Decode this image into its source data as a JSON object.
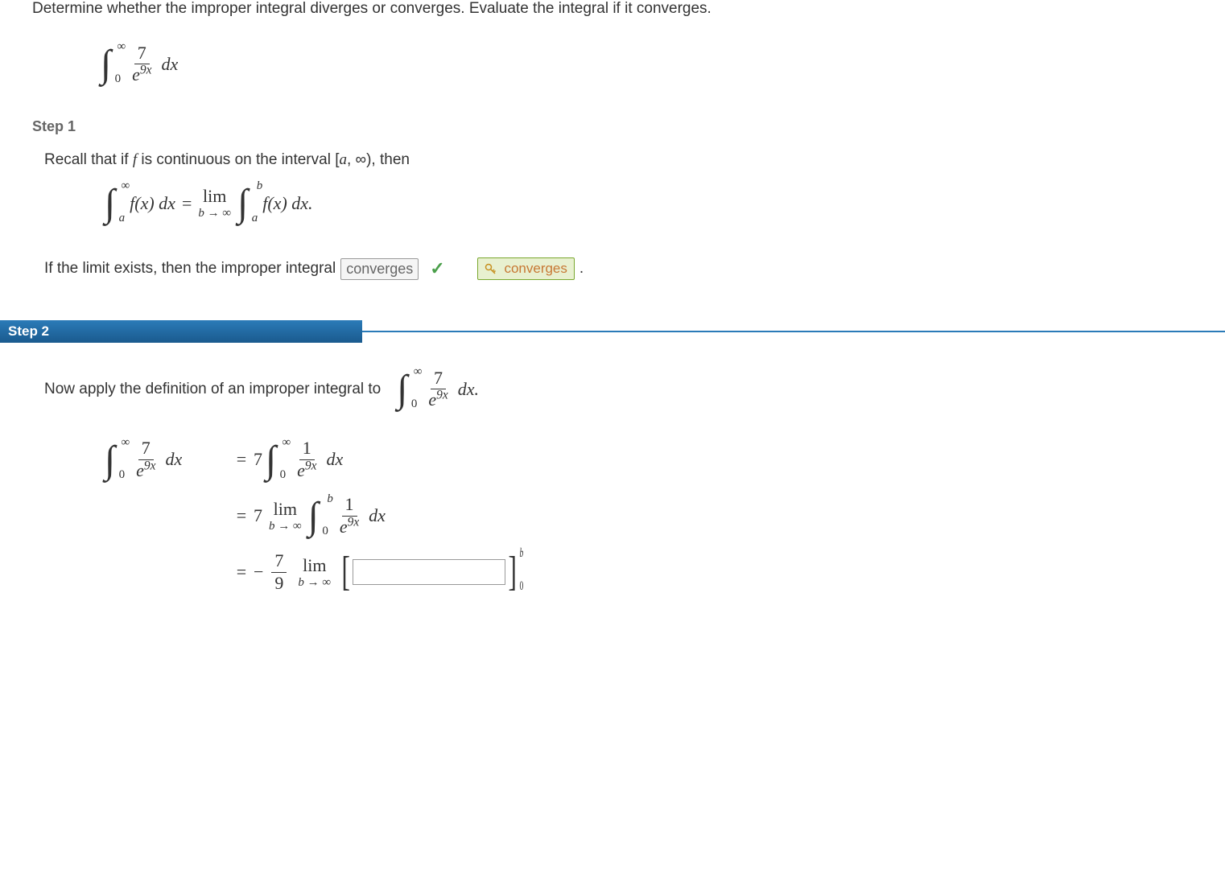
{
  "prompt": "Determine whether the improper integral diverges or converges. Evaluate the integral if it converges.",
  "integral": {
    "upper": "∞",
    "lower": "0",
    "num": "7",
    "den_base": "e",
    "den_exp": "9x",
    "dx": "dx"
  },
  "step1": {
    "header": "Step 1",
    "text1_pre": "Recall that if ",
    "text1_f": "f",
    "text1_mid": " is continuous on the interval  [",
    "text1_a": "a",
    "text1_inf": ", ∞),  then",
    "equation": {
      "int1_upper": "∞",
      "int1_lower": "a",
      "int1_body": "f(x) dx",
      "equals": " = ",
      "lim_top": "lim",
      "lim_bottom": "b → ∞",
      "int2_upper": "b",
      "int2_lower": "a",
      "int2_body": "f(x) dx."
    },
    "text2_pre": "If the limit exists, then the improper integral",
    "answer_given": "converges",
    "answer_correct": "converges",
    "text2_post": "."
  },
  "step2": {
    "header": "Step 2",
    "text1": "Now apply the definition of an improper integral to",
    "integral_expr": {
      "upper": "∞",
      "lower": "0",
      "num": "7",
      "den_exp": "9x",
      "dx": "dx."
    },
    "work": {
      "row1_left_upper": "∞",
      "row1_left_lower": "0",
      "row1_left_num": "7",
      "row1_left_exp": "9x",
      "row1_left_dx": "dx",
      "equals": "=",
      "row1_right_coef": "7",
      "row1_right_upper": "∞",
      "row1_right_lower": "0",
      "row1_right_num": "1",
      "row1_right_exp": "9x",
      "row1_right_dx": "dx",
      "row2_coef": "7",
      "row2_lim_top": "lim",
      "row2_lim_bot": "b → ∞",
      "row2_int_upper": "b",
      "row2_int_lower": "0",
      "row2_num": "1",
      "row2_exp": "9x",
      "row2_dx": "dx",
      "row3_neg": "−",
      "row3_frac_num": "7",
      "row3_frac_den": "9",
      "row3_lim_top": "lim",
      "row3_lim_bot": "b → ∞",
      "row3_bracket_upper": "b",
      "row3_bracket_lower": "0"
    }
  }
}
